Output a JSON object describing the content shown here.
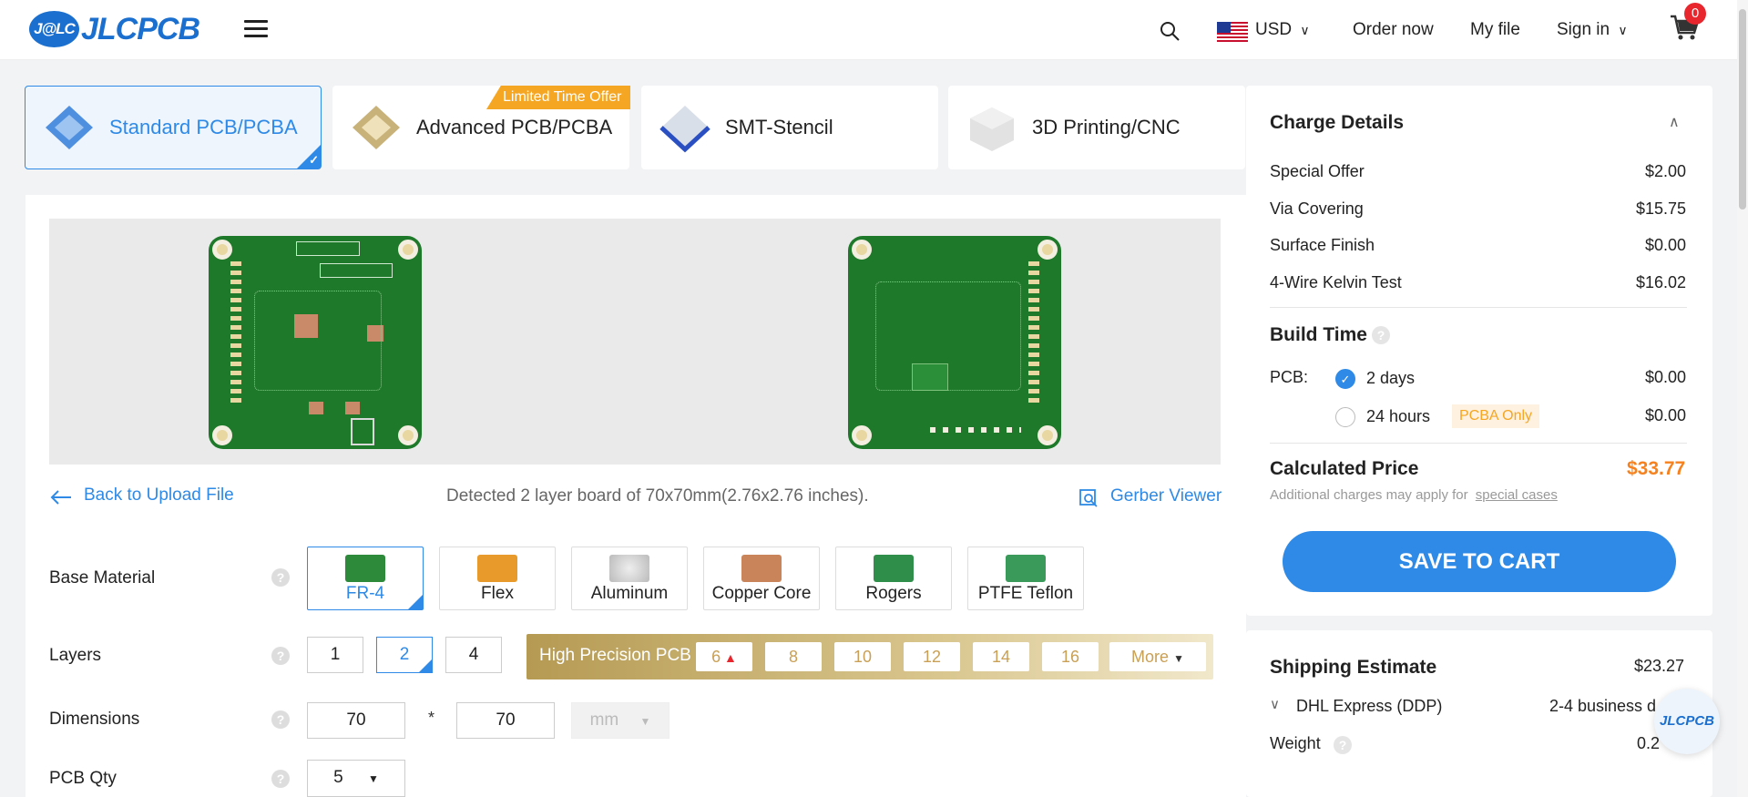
{
  "header": {
    "logo_badge": "J@LC",
    "logo_text": "JLCPCB",
    "currency": "USD",
    "order_now": "Order now",
    "my_file": "My file",
    "sign_in": "Sign in",
    "cart_count": "0"
  },
  "tabs": [
    {
      "label": "Standard PCB/PCBA",
      "active": true
    },
    {
      "label": "Advanced PCB/PCBA",
      "promo": "Limited Time Offer"
    },
    {
      "label": "SMT-Stencil"
    },
    {
      "label": "3D Printing/CNC"
    }
  ],
  "preview": {
    "back_link": "Back to Upload File",
    "detected": "Detected 2 layer board of 70x70mm(2.76x2.76 inches).",
    "gerber_viewer": "Gerber Viewer"
  },
  "form": {
    "base_material": {
      "label": "Base Material",
      "options": [
        "FR-4",
        "Flex",
        "Aluminum",
        "Copper Core",
        "Rogers",
        "PTFE Teflon"
      ],
      "selected": "FR-4"
    },
    "layers": {
      "label": "Layers",
      "options": [
        "1",
        "2",
        "4"
      ],
      "selected": "2",
      "high_precision_title": "High Precision PCB",
      "high_precision_options": [
        "6",
        "8",
        "10",
        "12",
        "14",
        "16"
      ],
      "more": "More"
    },
    "dimensions": {
      "label": "Dimensions",
      "width": "70",
      "separator": "*",
      "height": "70",
      "unit": "mm"
    },
    "qty": {
      "label": "PCB Qty",
      "value": "5"
    }
  },
  "charge": {
    "title": "Charge Details",
    "items": [
      {
        "label": "Special Offer",
        "value": "$2.00"
      },
      {
        "label": "Via Covering",
        "value": "$15.75"
      },
      {
        "label": "Surface Finish",
        "value": "$0.00"
      },
      {
        "label": "4-Wire Kelvin Test",
        "value": "$16.02"
      }
    ],
    "build_time_title": "Build Time",
    "pcb_label": "PCB:",
    "build_options": [
      {
        "label": "2 days",
        "value": "$0.00",
        "selected": true
      },
      {
        "label": "24 hours",
        "value": "$0.00",
        "badge": "PCBA Only"
      }
    ],
    "calculated_label": "Calculated Price",
    "calculated_value": "$33.77",
    "note_prefix": "Additional charges may apply for",
    "note_link": "special cases",
    "save_button": "SAVE TO CART",
    "accent_color": "#f5821f",
    "primary_color": "#2e8ae6"
  },
  "shipping": {
    "title": "Shipping Estimate",
    "value": "$23.27",
    "method": "DHL Express (DDP)",
    "duration": "2-4 business d",
    "weight_label": "Weight",
    "weight_value": "0.2"
  },
  "floating_badge": "JLCPCB"
}
